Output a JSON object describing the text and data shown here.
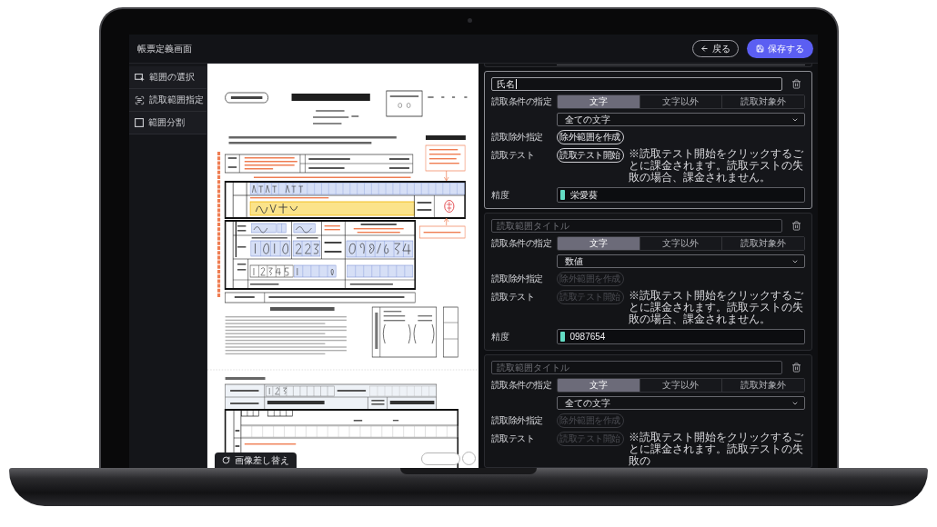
{
  "header": {
    "title": "帳票定義画面",
    "buttons": [
      {
        "kind": "back",
        "label": "戻る"
      },
      {
        "kind": "save",
        "label": "保存する"
      }
    ]
  },
  "sidebar": {
    "items": [
      {
        "kind": "select",
        "label": "範囲の選択"
      },
      {
        "kind": "read",
        "label": "読取範囲指定"
      },
      {
        "kind": "split",
        "label": "範囲分割"
      }
    ]
  },
  "document": {
    "replace_button": "画像差し替え"
  },
  "cards": [
    {
      "selected": true,
      "title": {
        "value": "氏名",
        "focused": true
      },
      "condition_label": "読取条件の指定",
      "condition_options": [
        {
          "label": "文字",
          "selected": true
        },
        {
          "label": "文字以外",
          "selected": false
        },
        {
          "label": "読取対象外",
          "selected": false
        }
      ],
      "dropdown": "全ての文字",
      "exclusion_label": "読取除外指定",
      "exclusion_button": {
        "label": "除外範囲を作成",
        "disabled": false
      },
      "test_label": "読取テスト",
      "test_button": {
        "label": "読取テスト開始",
        "disabled": false
      },
      "test_note": "※読取テスト開始をクリックするごとに課金されます。読取テストの失敗の場合、課金されません。",
      "accuracy_label": "精度",
      "accuracy_value": "栄愛葵"
    },
    {
      "selected": false,
      "title": {
        "placeholder": "読取範囲タイトル",
        "focused": false
      },
      "condition_label": "読取条件の指定",
      "condition_options": [
        {
          "label": "文字",
          "selected": true
        },
        {
          "label": "文字以外",
          "selected": false
        },
        {
          "label": "読取対象外",
          "selected": false
        }
      ],
      "dropdown": "数値",
      "exclusion_label": "読取除外指定",
      "exclusion_button": {
        "label": "除外範囲を作成",
        "disabled": true
      },
      "test_label": "読取テスト",
      "test_button": {
        "label": "読取テスト開始",
        "disabled": true
      },
      "test_note": "※読取テスト開始をクリックするごとに課金されます。読取テストの失敗の場合、課金されません。",
      "accuracy_label": "精度",
      "accuracy_value": "0987654"
    },
    {
      "selected": false,
      "title": {
        "placeholder": "読取範囲タイトル",
        "focused": false
      },
      "condition_label": "読取条件の指定",
      "condition_options": [
        {
          "label": "文字",
          "selected": true
        },
        {
          "label": "文字以外",
          "selected": false
        },
        {
          "label": "読取対象外",
          "selected": false
        }
      ],
      "dropdown": "全ての文字",
      "exclusion_label": "読取除外指定",
      "exclusion_button": {
        "label": "除外範囲を作成",
        "disabled": true
      },
      "test_label": "読取テスト",
      "test_button": {
        "label": "読取テスト開始",
        "disabled": true
      },
      "test_note": "※読取テスト開始をクリックするごとに課金されます。読取テストの失敗の"
    }
  ]
}
